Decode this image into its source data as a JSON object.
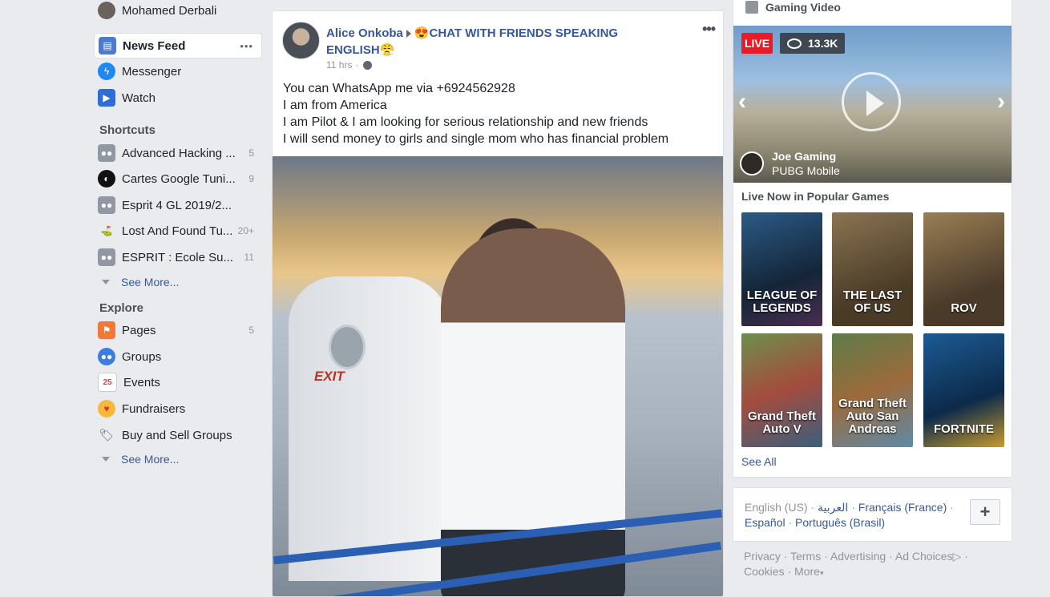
{
  "sidebar": {
    "profile_name": "Mohamed Derbali",
    "main": [
      {
        "label": "News Feed",
        "icon": "news-feed-icon"
      },
      {
        "label": "Messenger",
        "icon": "messenger-icon"
      },
      {
        "label": "Watch",
        "icon": "watch-icon"
      }
    ],
    "more_dots": "•••",
    "shortcuts_heading": "Shortcuts",
    "shortcuts": [
      {
        "label": "Advanced Hacking ...",
        "count": "5"
      },
      {
        "label": "Cartes Google Tuni...",
        "count": "9"
      },
      {
        "label": "Esprit 4 GL 2019/2...",
        "count": ""
      },
      {
        "label": "Lost And Found Tu...",
        "count": "20+"
      },
      {
        "label": "ESPRIT : Ecole Su...",
        "count": "11"
      }
    ],
    "see_more_1": "See More...",
    "explore_heading": "Explore",
    "explore": [
      {
        "label": "Pages",
        "count": "5"
      },
      {
        "label": "Groups",
        "count": ""
      },
      {
        "label": "Events",
        "count": ""
      },
      {
        "label": "Fundraisers",
        "count": ""
      },
      {
        "label": "Buy and Sell Groups",
        "count": ""
      }
    ],
    "see_more_2": "See More..."
  },
  "post": {
    "author": "Alice Onkoba",
    "target": "😍CHAT WITH FRIENDS SPEAKING ENGLISH😤",
    "time": "11 hrs",
    "dot": "·",
    "more": "•••",
    "text_lines": [
      "You can WhatsApp me via +6924562928",
      "I am from America",
      "I am Pilot & I am looking for serious relationship and new friends",
      "I will send money to girls and single mom who has financial problem"
    ],
    "image_text": "EXIT"
  },
  "gaming": {
    "title": "Gaming Video",
    "live": "LIVE",
    "viewers": "13.3K",
    "streamer": "Joe Gaming",
    "game": "PUBG Mobile",
    "popular_heading": "Live Now in Popular Games",
    "games": [
      {
        "name": "LEAGUE OF LEGENDS",
        "color": "#1c3a56"
      },
      {
        "name": "THE LAST OF US",
        "color": "#6e5a3b"
      },
      {
        "name": "ROV",
        "color": "#7a5f3a"
      },
      {
        "name": "Grand Theft Auto V",
        "color": "#3a6b3e"
      },
      {
        "name": "Grand Theft Auto San Andreas",
        "color": "#5f7a4a"
      },
      {
        "name": "FORTNITE",
        "color": "#1f5d8f"
      }
    ],
    "see_all": "See All"
  },
  "languages": {
    "current": "English (US)",
    "arabic": "العربية",
    "french": "Français (France)",
    "spanish": "Español",
    "portuguese": "Português (Brasil)",
    "sep": "·",
    "plus": "+"
  },
  "footer": {
    "privacy": "Privacy",
    "terms": "Terms",
    "advertising": "Advertising",
    "ad_choices": "Ad Choices",
    "cookies": "Cookies",
    "more": "More",
    "sep": "·"
  }
}
